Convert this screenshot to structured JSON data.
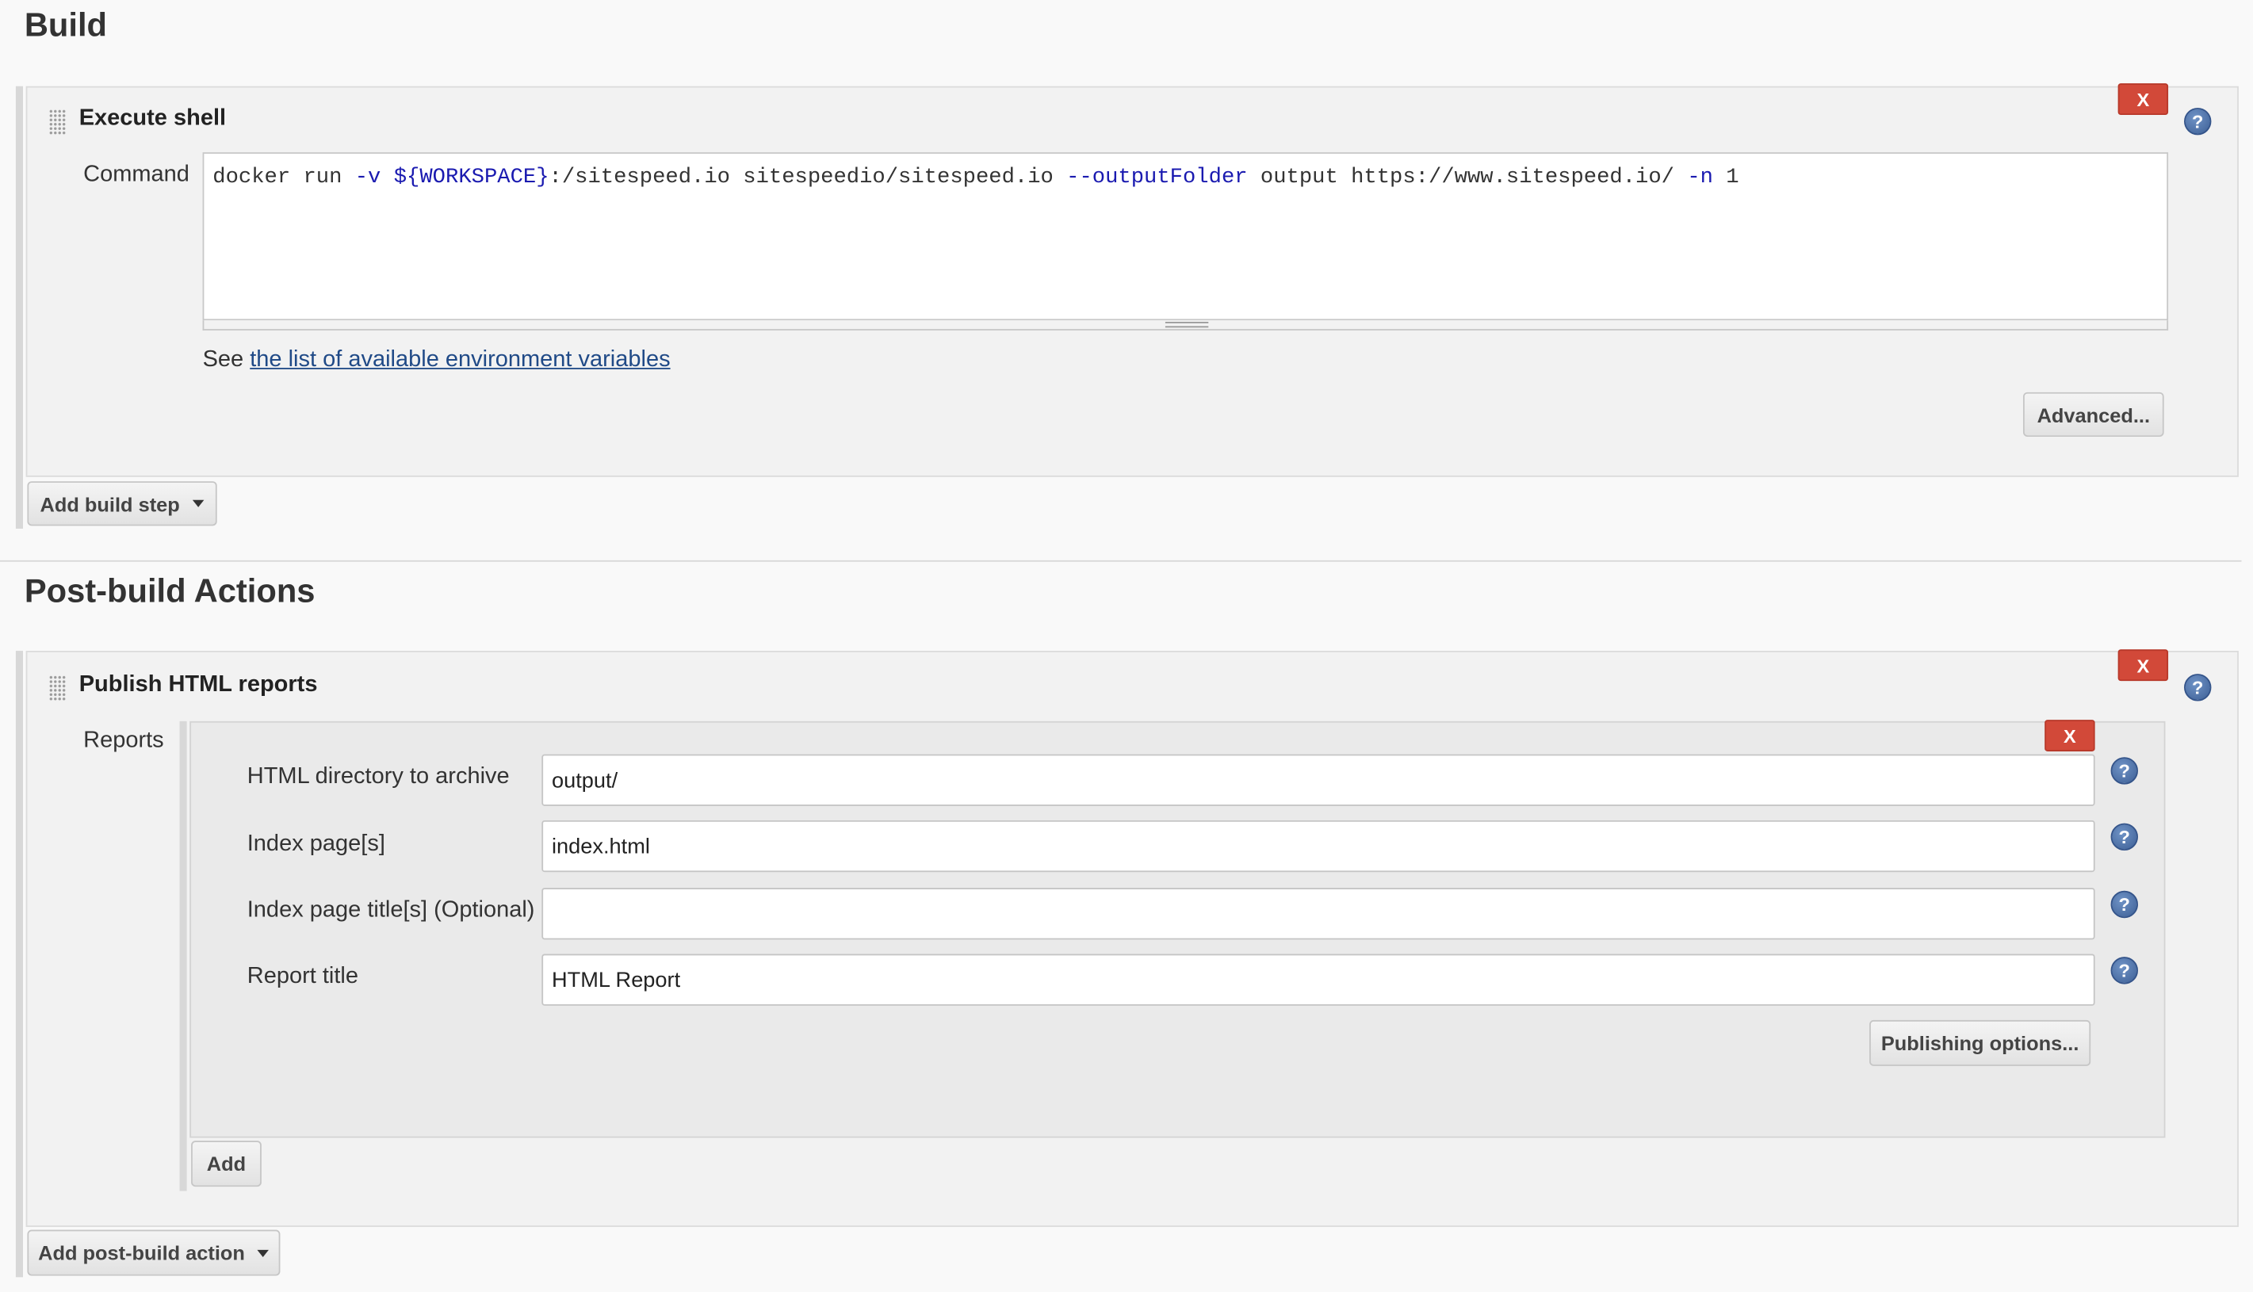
{
  "build": {
    "title": "Build",
    "execute_shell": {
      "title": "Execute shell",
      "delete_label": "X",
      "help": "?",
      "command_label": "Command",
      "command": {
        "p1": "docker run ",
        "t1": "-v",
        "p2": " ",
        "t2": "${WORKSPACE}",
        "p3": ":/sitespeed.io sitespeedio/sitespeed.io ",
        "t3": "--outputFolder",
        "p4": " output https://www.sitespeed.io/ ",
        "t4": "-n",
        "p5": " 1"
      },
      "see_prefix": "See ",
      "env_link": "the list of available environment variables",
      "advanced_label": "Advanced..."
    },
    "add_step_label": "Add build step"
  },
  "post_build": {
    "title": "Post-build Actions",
    "publish_html": {
      "title": "Publish HTML reports",
      "delete_label": "X",
      "help": "?",
      "reports_label": "Reports",
      "report": {
        "delete_label": "X",
        "fields": [
          {
            "label": "HTML directory to archive",
            "value": "output/"
          },
          {
            "label": "Index page[s]",
            "value": "index.html"
          },
          {
            "label": "Index page title[s] (Optional)",
            "value": ""
          },
          {
            "label": "Report title",
            "value": "HTML Report"
          }
        ],
        "publishing_options_label": "Publishing options..."
      },
      "add_label": "Add"
    },
    "add_action_label": "Add post-build action"
  }
}
